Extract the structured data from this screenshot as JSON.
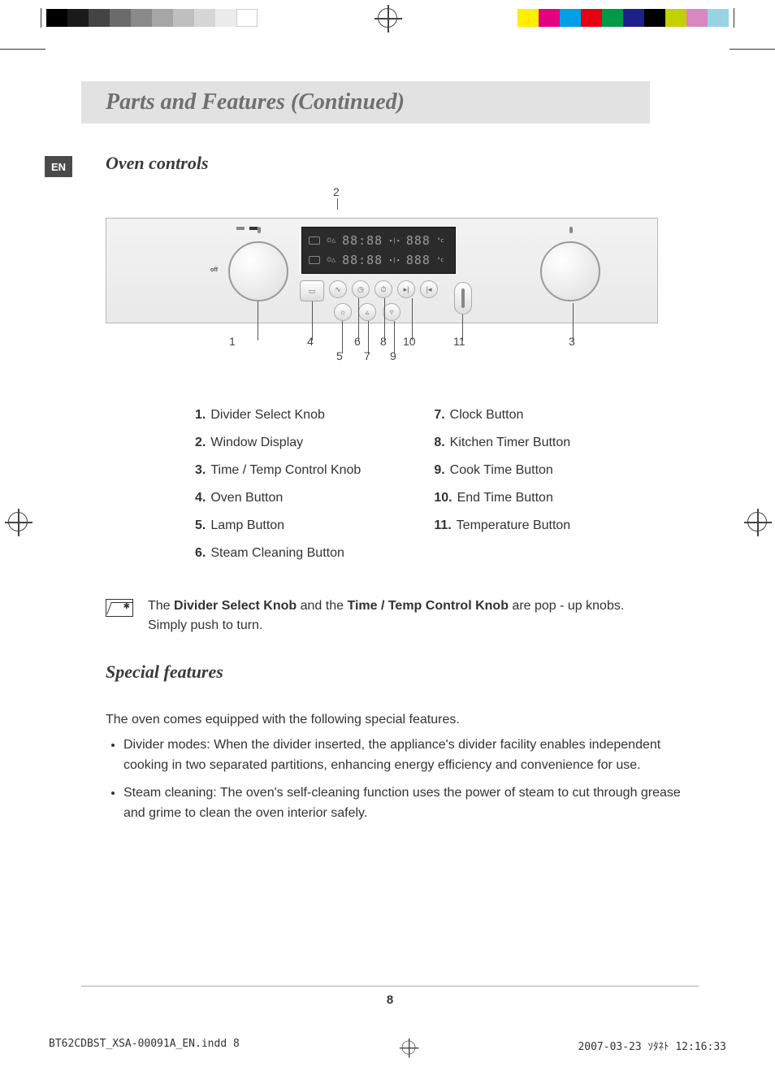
{
  "print_bar": {
    "grays": [
      "#000",
      "#1a1a1a",
      "#444",
      "#6b6b6b",
      "#8a8a8a",
      "#a6a6a6",
      "#bfbfbf",
      "#d6d6d6",
      "#ececec",
      "#fff"
    ],
    "colors": [
      "#ffee00",
      "#e4007f",
      "#00a0e9",
      "#e60012",
      "#009944",
      "#1d2088",
      "#000000",
      "#c3a500",
      "#b73c8e",
      "#6bbfd0"
    ]
  },
  "lang_badge": "EN",
  "title": "Parts and Features (Continued)",
  "subhead_controls": "Oven controls",
  "panel": {
    "off_label": "off",
    "display_rows": [
      {
        "time": "88:88",
        "temp": "888"
      },
      {
        "time": "88:88",
        "temp": "888"
      }
    ],
    "degree_unit": "°c"
  },
  "callouts": {
    "top": "2",
    "row1": [
      "1",
      "4",
      "6",
      "8",
      "10",
      "11",
      "3"
    ],
    "row2": [
      "5",
      "7",
      "9"
    ]
  },
  "legend_left": [
    {
      "n": "1.",
      "t": "Divider Select Knob"
    },
    {
      "n": "2.",
      "t": "Window Display"
    },
    {
      "n": "3.",
      "t": "Time / Temp Control Knob"
    },
    {
      "n": "4.",
      "t": "Oven Button"
    },
    {
      "n": "5.",
      "t": "Lamp Button"
    },
    {
      "n": "6.",
      "t": "Steam Cleaning Button"
    }
  ],
  "legend_right": [
    {
      "n": "7.",
      "t": "Clock Button"
    },
    {
      "n": "8.",
      "t": "Kitchen Timer Button"
    },
    {
      "n": "9.",
      "t": "Cook Time Button"
    },
    {
      "n": "10.",
      "t": "End Time Button"
    },
    {
      "n": "11.",
      "t": "Temperature Button"
    }
  ],
  "note": {
    "line1_a": "The ",
    "line1_b1": "Divider Select Knob",
    "line1_c": " and the ",
    "line1_b2": "Time / Temp Control Knob",
    "line1_d": " are pop - up knobs.",
    "line2": "Simply push to turn."
  },
  "subhead_features": "Special features",
  "features_intro": "The oven comes equipped with the following special features.",
  "features_bullets": [
    "Divider modes: When the divider inserted, the appliance's divider facility enables independent cooking in two separated partitions, enhancing energy efficiency and convenience for use.",
    "Steam cleaning: The oven's self-cleaning function uses the power of steam to cut through grease and grime to clean the oven interior safely."
  ],
  "page_number": "8",
  "slug": {
    "file": "BT62CDBST_XSA-00091A_EN.indd   8",
    "date": "2007-03-23   ｿﾀﾈﾄ 12:16:33"
  }
}
